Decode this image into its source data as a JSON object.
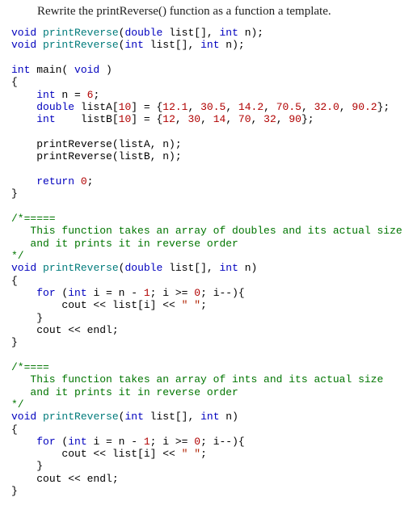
{
  "prompt": "Rewrite the printReverse() function as a function a template.",
  "proto1": {
    "kw_void": "void",
    "name": "printReverse",
    "lp": "(",
    "kw_double": "double",
    "p": " list[], ",
    "kw_int": "int",
    "tail": " n);"
  },
  "proto2": {
    "kw_void": "void",
    "name": "printReverse",
    "lp": "(",
    "kw_int1": "int",
    "p": " list[], ",
    "kw_int2": "int",
    "tail": " n);"
  },
  "main": {
    "sig1": "int",
    "sig2": " main( ",
    "sig3": "void",
    "sig4": " )",
    "lb": "{",
    "dn1": "int",
    "dn2": " n = ",
    "dn3": "6",
    "dn4": ";",
    "da1": "double",
    "da2": " listA[",
    "da3": "10",
    "da4": "] = {",
    "da5": "12.1",
    "da6": ", ",
    "da7": "30.5",
    "da8": ", ",
    "da9": "14.2",
    "da10": ", ",
    "da11": "70.5",
    "da12": ", ",
    "da13": "32.0",
    "da14": ", ",
    "da15": "90.2",
    "da16": "};",
    "db1": "int",
    "db2": "    listB[",
    "db3": "10",
    "db4": "] = {",
    "db5": "12",
    "db6": ", ",
    "db7": "30",
    "db8": ", ",
    "db9": "14",
    "db10": ", ",
    "db11": "70",
    "db12": ", ",
    "db13": "32",
    "db14": ", ",
    "db15": "90",
    "db16": "};",
    "c1": "printReverse(listA, n);",
    "c2": "printReverse(listB, n);",
    "r1": "return",
    "r2": " ",
    "r3": "0",
    "r4": ";",
    "rb": "}"
  },
  "f1c": {
    "l1": "/*=====",
    "l2": "   This function takes an array of doubles and its actual size",
    "l3": "   and it prints it in reverse order",
    "l4": "*/"
  },
  "f1": {
    "kw_void": "void",
    "name": "printReverse",
    "lp": "(",
    "kw_double": "double",
    "p": " list[], ",
    "kw_int": "int",
    "tail": " n)",
    "lb": "{",
    "for1": "for",
    "for2": " (",
    "for3": "int",
    "for4": " i = n - ",
    "for5": "1",
    "for6": "; i >= ",
    "for7": "0",
    "for8": "; i--){",
    "body1": "cout << list[i] << ",
    "body2": "\" \"",
    "body3": ";",
    "fcb": "}",
    "endl": "cout << endl;",
    "rb": "}"
  },
  "f2c": {
    "l1": "/*====",
    "l2": "   This function takes an array of ints and its actual size",
    "l3": "   and it prints it in reverse order",
    "l4": "*/"
  },
  "f2": {
    "kw_void": "void",
    "name": "printReverse",
    "lp": "(",
    "kw_int1": "int",
    "p": " list[], ",
    "kw_int2": "int",
    "tail": " n)",
    "lb": "{",
    "for1": "for",
    "for2": " (",
    "for3": "int",
    "for4": " i = n - ",
    "for5": "1",
    "for6": "; i >= ",
    "for7": "0",
    "for8": "; i--){",
    "body1": "cout << list[i] << ",
    "body2": "\" \"",
    "body3": ";",
    "fcb": "}",
    "endl": "cout << endl;",
    "rb": "}"
  }
}
